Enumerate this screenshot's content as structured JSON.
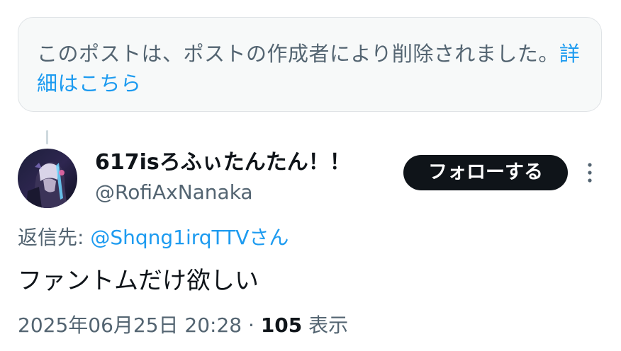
{
  "notice": {
    "text": "このポストは、ポストの作成者により削除されました。",
    "link": "詳細はこちら"
  },
  "post": {
    "author": {
      "display_name": "617isろふぃたんたん！！",
      "handle": "@RofiAxNanaka"
    },
    "follow_label": "フォローする",
    "reply_to": {
      "prefix": "返信先: ",
      "mention": "@Shqng1irqTTVさん"
    },
    "text": "ファントムだけ欲しい",
    "timestamp": "2025年06月25日 20:28",
    "separator": " · ",
    "views_count": "105",
    "views_label": " 表示"
  },
  "colors": {
    "link": "#1d9bf0",
    "secondary_text": "#536471",
    "primary_text": "#0f1419",
    "follow_bg": "#0f1419"
  },
  "icons": {
    "more": "more-vertical-icon"
  }
}
